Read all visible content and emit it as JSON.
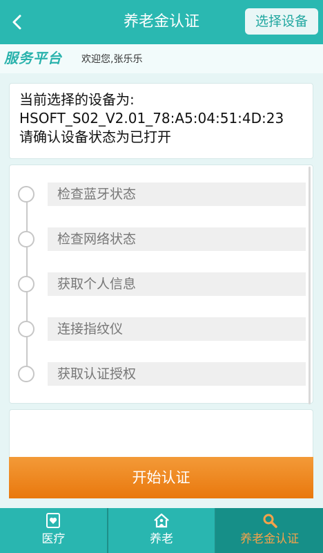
{
  "header": {
    "title": "养老金认证",
    "back_icon": "chevron-left-icon",
    "select_device_label": "选择设备"
  },
  "welcome_bar": {
    "logo_text": "服务平台",
    "welcome_text": "欢迎您,张乐乐"
  },
  "device_info": {
    "line1": "当前选择的设备为:",
    "line2": "HSOFT_S02_V2.01_78:A5:04:51:4D:23",
    "line3": "请确认设备状态为已打开"
  },
  "steps": [
    {
      "label": "检查蓝牙状态"
    },
    {
      "label": "检查网络状态"
    },
    {
      "label": "获取个人信息"
    },
    {
      "label": "连接指纹仪"
    },
    {
      "label": "获取认证授权"
    }
  ],
  "start_button_label": "开始认证",
  "tabs": [
    {
      "label": "医疗",
      "icon": "heart-card-icon",
      "active": false
    },
    {
      "label": "养老",
      "icon": "house-person-icon",
      "active": false
    },
    {
      "label": "养老金认证",
      "icon": "magnifier-icon",
      "active": true
    }
  ],
  "colors": {
    "primary": "#2ab8b1",
    "accent_orange": "#ed8420",
    "tab_active_text": "#f6a24a"
  }
}
